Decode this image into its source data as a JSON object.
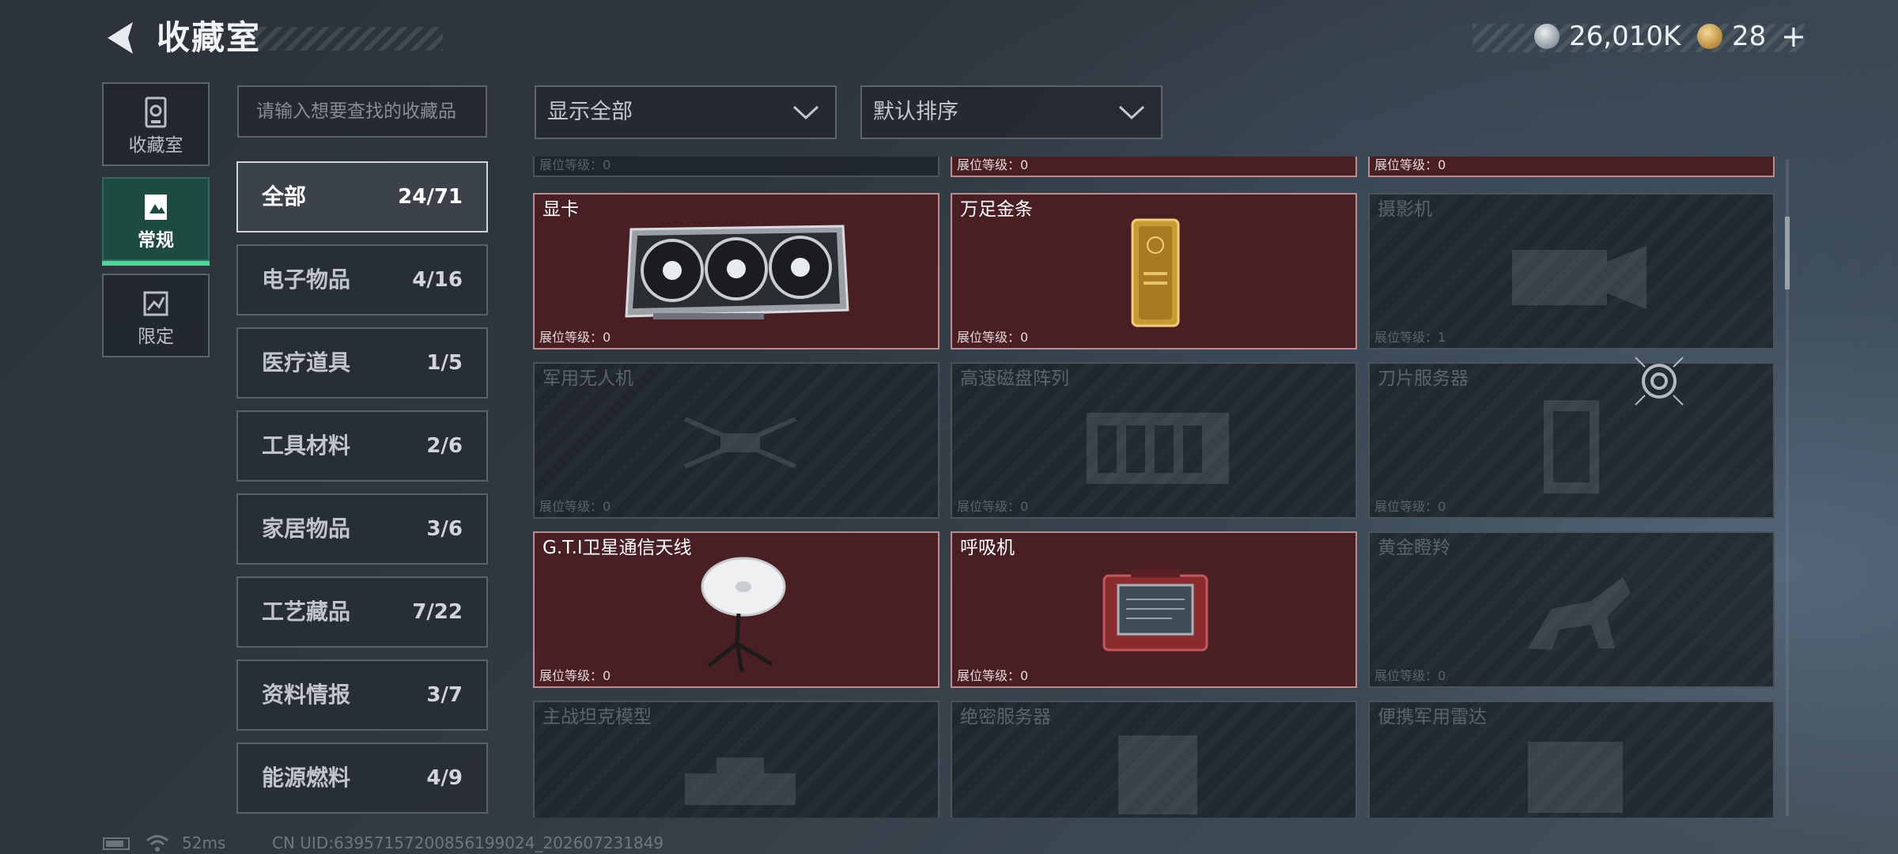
{
  "header": {
    "title": "收藏室",
    "currency_silver": "26,010K",
    "currency_gold": "28",
    "add_label": "+"
  },
  "rail": [
    {
      "label": "收藏室",
      "icon": "collection-room-icon"
    },
    {
      "label": "常规",
      "icon": "regular-collection-icon",
      "active": true
    },
    {
      "label": "限定",
      "icon": "limited-collection-icon"
    }
  ],
  "search": {
    "placeholder": "请输入想要查找的收藏品"
  },
  "categories": [
    {
      "label": "全部",
      "count": "24/71",
      "active": true
    },
    {
      "label": "电子物品",
      "count": "4/16"
    },
    {
      "label": "医疗道具",
      "count": "1/5"
    },
    {
      "label": "工具材料",
      "count": "2/6"
    },
    {
      "label": "家居物品",
      "count": "3/6"
    },
    {
      "label": "工艺藏品",
      "count": "7/22"
    },
    {
      "label": "资料情报",
      "count": "3/7"
    },
    {
      "label": "能源燃料",
      "count": "4/9"
    }
  ],
  "filters": {
    "display": "显示全部",
    "sort": "默认排序"
  },
  "level_label": "展位等级：",
  "top_row_levels": [
    "0",
    "0",
    "0"
  ],
  "items": [
    {
      "name": "显卡",
      "level": "0",
      "owned": true,
      "art": "graphics-card"
    },
    {
      "name": "万足金条",
      "level": "0",
      "owned": true,
      "art": "gold-bar"
    },
    {
      "name": "摄影机",
      "level": "1",
      "owned": false,
      "art": "camera"
    },
    {
      "name": "军用无人机",
      "level": "0",
      "owned": false,
      "art": "drone"
    },
    {
      "name": "高速磁盘阵列",
      "level": "0",
      "owned": false,
      "art": "disk-array"
    },
    {
      "name": "刀片服务器",
      "level": "0",
      "owned": false,
      "art": "blade-server"
    },
    {
      "name": "G.T.I卫星通信天线",
      "level": "0",
      "owned": true,
      "art": "satellite-antenna"
    },
    {
      "name": "呼吸机",
      "level": "0",
      "owned": true,
      "art": "ventilator"
    },
    {
      "name": "黄金瞪羚",
      "level": "0",
      "owned": false,
      "art": "golden-gazelle"
    },
    {
      "name": "主战坦克模型",
      "level": "",
      "owned": false,
      "art": "tank-model"
    },
    {
      "name": "绝密服务器",
      "level": "",
      "owned": false,
      "art": "secret-server"
    },
    {
      "name": "便携军用雷达",
      "level": "",
      "owned": false,
      "art": "portable-radar"
    }
  ],
  "footer": {
    "ping": "52ms",
    "uid": "CN UID:6395715720085619​9024_202607231849"
  }
}
